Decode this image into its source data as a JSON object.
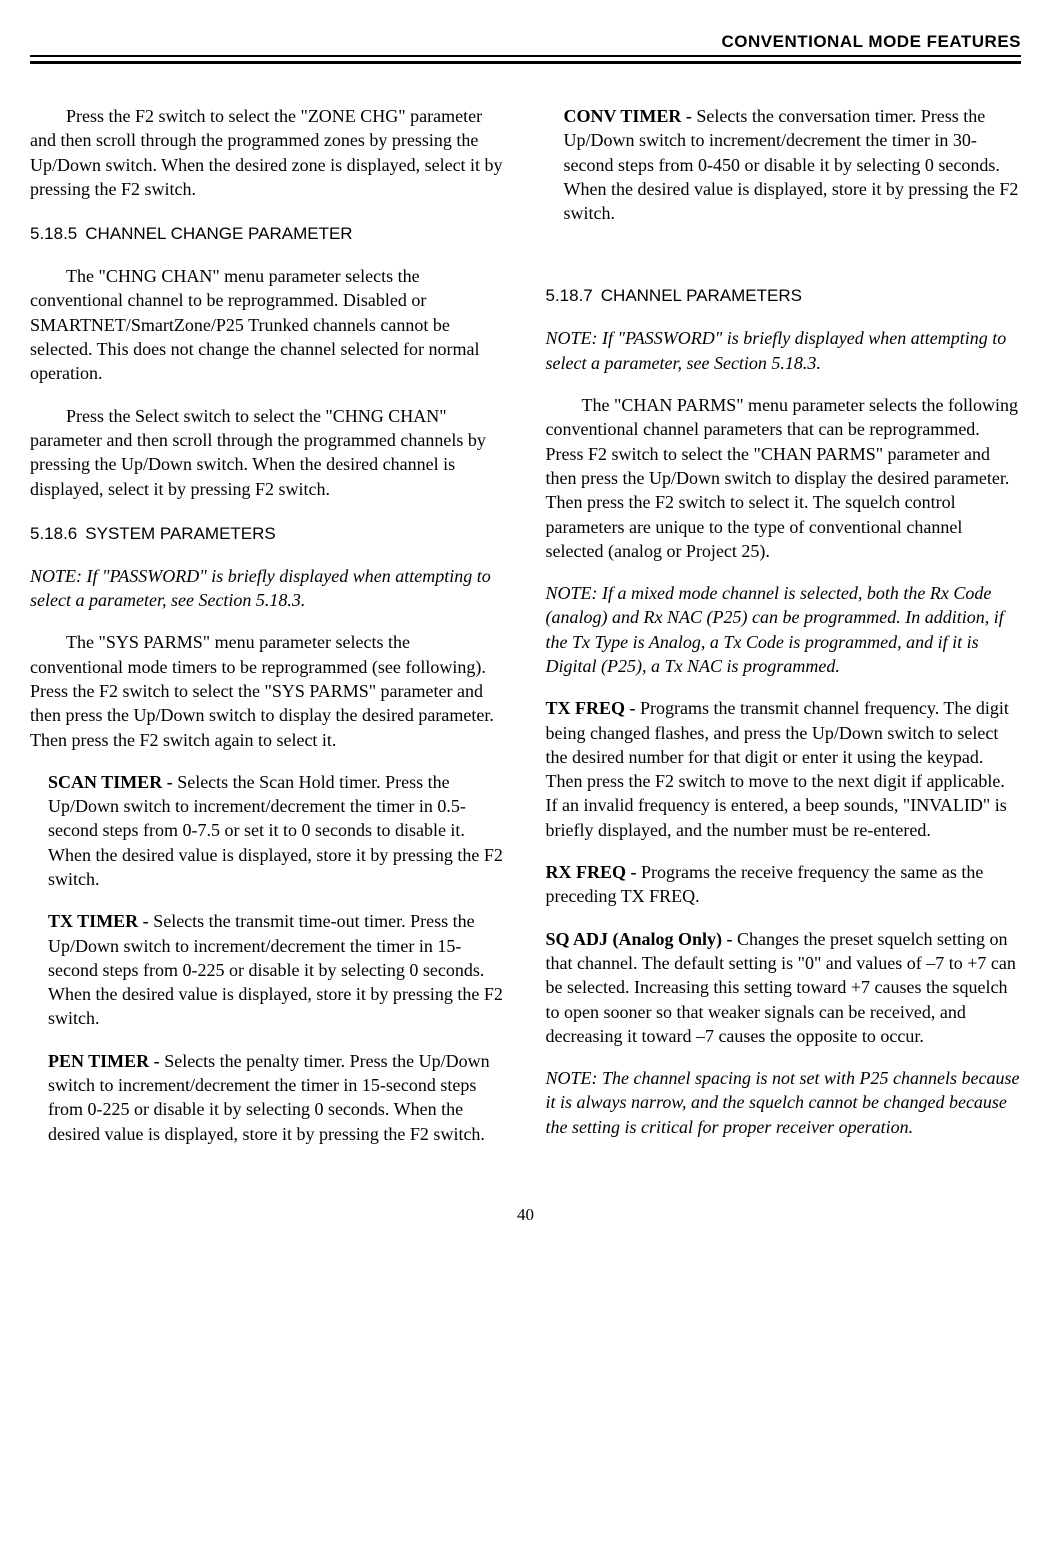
{
  "header": "CONVENTIONAL MODE FEATURES",
  "page_number": "40",
  "left": {
    "p1": "Press the F2 switch to select the \"ZONE CHG\" parameter and then scroll through the programmed zones by pressing the Up/Down switch. When the desired zone is displayed, select it by pressing the F2 switch.",
    "h1_num": "5.18.5",
    "h1_title": "CHANNEL CHANGE PARAMETER",
    "p2": "The \"CHNG CHAN\" menu parameter selects the conventional channel to be reprogrammed. Disabled or SMARTNET/SmartZone/P25 Trunked channels cannot be selected. This does not change the channel selected for normal operation.",
    "p3": "Press the Select switch to select the \"CHNG CHAN\" parameter and then scroll through the programmed channels by pressing the Up/Down switch. When the desired channel is displayed, select it by pressing F2 switch.",
    "h2_num": "5.18.6",
    "h2_title": "SYSTEM PARAMETERS",
    "note1": "NOTE: If \"PASSWORD\" is briefly displayed when attempting to select a parameter, see Section 5.18.3.",
    "p4": "The \"SYS PARMS\" menu parameter selects the conventional mode timers to be reprogrammed (see following). Press the F2 switch to select the \"SYS PARMS\" parameter and then press the Up/Down switch to display the desired parameter. Then press the F2 switch again to select it.",
    "d1_label": "SCAN TIMER - ",
    "d1_text": "Selects the Scan Hold timer. Press the Up/Down switch to increment/decrement the timer in 0.5-second steps from 0-7.5 or set it to 0 seconds to disable it. When the desired value is displayed, store it by pressing the F2 switch.",
    "d2_label": "TX TIMER - ",
    "d2_text": "Selects the transmit time-out timer. Press the Up/Down switch to increment/decrement the timer in 15-second steps from 0-225 or disable it by selecting 0 seconds. When the desired value is displayed, store it by pressing the F2 switch.",
    "d3_label": "PEN TIMER - ",
    "d3_text": "Selects the penalty timer. Press the Up/Down switch to increment/decrement the timer in 15-second steps from 0-225 or disable it by selecting 0 seconds. When the desired value is displayed, store it by pressing the F2 switch."
  },
  "right": {
    "d4_label": "CONV TIMER - ",
    "d4_text": "Selects the conversation timer. Press the Up/Down switch to increment/decrement the timer in 30-second steps from 0-450 or disable it by selecting 0 seconds. When the desired value is displayed, store it by pressing the F2 switch.",
    "h3_num": "5.18.7",
    "h3_title": "CHANNEL PARAMETERS",
    "note2": "NOTE: If \"PASSWORD\" is briefly displayed when attempting to select a parameter, see Section 5.18.3.",
    "p5": "The \"CHAN PARMS\" menu parameter selects the following conventional channel parameters that can be reprogrammed. Press F2 switch to select the \"CHAN PARMS\" parameter and then press the Up/Down switch to display the desired parameter. Then press the F2 switch to select it. The squelch control parameters are unique to the type of conventional channel selected (analog or Project 25).",
    "note3": "NOTE: If a mixed mode channel is selected, both the Rx Code (analog) and Rx NAC (P25) can be programmed. In addition, if the Tx Type is Analog, a Tx Code is programmed, and if it is Digital (P25), a Tx NAC is programmed.",
    "d5_label": "TX FREQ - ",
    "d5_text": "Programs the transmit channel frequency. The digit being changed flashes, and press the Up/Down switch to select the desired number for that digit or enter it using the keypad. Then press the F2 switch to move to the next digit if applicable. If an invalid frequency is entered, a beep sounds, \"INVALID\" is briefly displayed, and the number must be re-entered.",
    "d6_label": "RX FREQ - ",
    "d6_text": "Programs the receive frequency the same as the preceding TX FREQ.",
    "d7_label": "SQ ADJ (Analog Only) - ",
    "d7_text": "Changes the preset squelch setting on that channel. The default setting is \"0\" and values of –7 to +7 can be selected. Increasing this setting toward +7 causes the squelch to open sooner so that weaker signals can be received, and decreasing it toward –7 causes the opposite to occur.",
    "note4": "NOTE: The channel spacing is not set with P25 channels because it is always narrow, and the squelch cannot be changed because the setting is critical for proper receiver operation."
  }
}
